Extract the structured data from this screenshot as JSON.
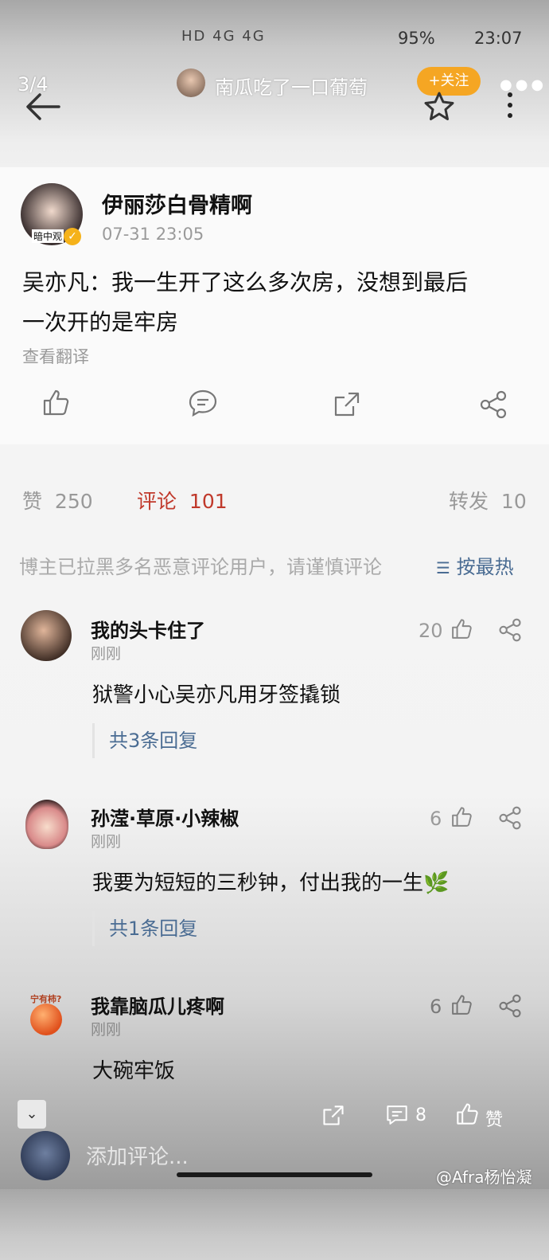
{
  "status": {
    "signal_icons": "HD 4G 4G",
    "battery": "95%",
    "time": "23:07"
  },
  "topbar": {
    "page_indicator": "3/4",
    "user_name": "南瓜吃了一口葡萄",
    "follow_label": "+关注"
  },
  "post": {
    "author": "伊丽莎白骨精啊",
    "avatar_badge": "暗中观",
    "time": "07-31 23:05",
    "text_line1": "吴亦凡：我一生开了这么多次房，没想到最后",
    "text_line2": "一次开的是牢房",
    "translate_label": "查看翻译"
  },
  "stats": {
    "likes_label": "赞",
    "likes_count": "250",
    "comments_label": "评论",
    "comments_count": "101",
    "reposts_label": "转发",
    "reposts_count": "10",
    "notice": "博主已拉黑多名恶意评论用户，请谨慎评论",
    "sort_label": "按最热"
  },
  "comments": [
    {
      "user": "我的头卡住了",
      "time": "刚刚",
      "text": "狱警小心吴亦凡用牙签撬锁",
      "likes": "20",
      "replies": "共3条回复"
    },
    {
      "user": "孙滢·草原·小辣椒",
      "time": "刚刚",
      "text": "我要为短短的三秒钟，付出我的一生",
      "likes": "6",
      "replies": "共1条回复"
    },
    {
      "user": "我靠脑瓜儿疼啊",
      "avatar_badge": "宁有柿?",
      "time": "刚刚",
      "text": "大碗牢饭",
      "likes": "6"
    }
  ],
  "bottom": {
    "comment_count": "8",
    "like_label": "赞",
    "input_placeholder": "添加评论...",
    "watermark": "@Afra杨怡凝"
  },
  "colors": {
    "accent_red": "#c0392b",
    "follow_orange": "#f5a623",
    "link_blue": "#4a6c93"
  }
}
